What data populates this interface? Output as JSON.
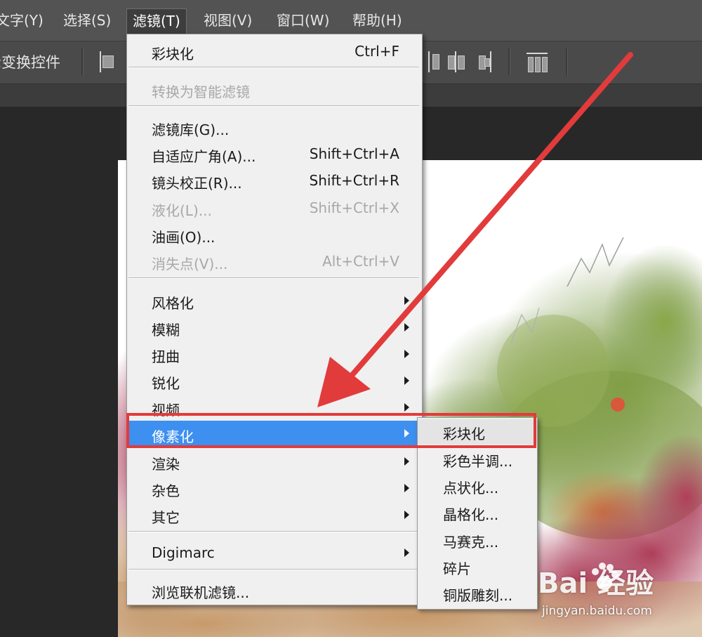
{
  "menubar": {
    "items": [
      {
        "label": "文字(Y)"
      },
      {
        "label": "选择(S)"
      },
      {
        "label": "滤镜(T)"
      },
      {
        "label": "视图(V)"
      },
      {
        "label": "窗口(W)"
      },
      {
        "label": "帮助(H)"
      }
    ]
  },
  "options_bar": {
    "label": "显示变换控件"
  },
  "filter_menu": {
    "items": [
      {
        "label": "彩块化",
        "shortcut": "Ctrl+F",
        "state": "enabled"
      },
      {
        "label": "转换为智能滤镜",
        "shortcut": "",
        "state": "disabled"
      },
      {
        "label": "滤镜库(G)...",
        "shortcut": "",
        "state": "enabled"
      },
      {
        "label": "自适应广角(A)...",
        "shortcut": "Shift+Ctrl+A",
        "state": "enabled"
      },
      {
        "label": "镜头校正(R)...",
        "shortcut": "Shift+Ctrl+R",
        "state": "enabled"
      },
      {
        "label": "液化(L)...",
        "shortcut": "Shift+Ctrl+X",
        "state": "disabled"
      },
      {
        "label": "油画(O)...",
        "shortcut": "",
        "state": "enabled"
      },
      {
        "label": "消失点(V)...",
        "shortcut": "Alt+Ctrl+V",
        "state": "disabled"
      },
      {
        "label": "风格化",
        "submenu": true
      },
      {
        "label": "模糊",
        "submenu": true
      },
      {
        "label": "扭曲",
        "submenu": true
      },
      {
        "label": "锐化",
        "submenu": true
      },
      {
        "label": "视频",
        "submenu": true
      },
      {
        "label": "像素化",
        "submenu": true,
        "highlighted": true
      },
      {
        "label": "渲染",
        "submenu": true
      },
      {
        "label": "杂色",
        "submenu": true
      },
      {
        "label": "其它",
        "submenu": true
      },
      {
        "label": "Digimarc",
        "submenu": true
      },
      {
        "label": "浏览联机滤镜..."
      }
    ]
  },
  "pixelate_submenu": {
    "items": [
      {
        "label": "彩块化"
      },
      {
        "label": "彩色半调..."
      },
      {
        "label": "点状化..."
      },
      {
        "label": "晶格化..."
      },
      {
        "label": "马赛克..."
      },
      {
        "label": "碎片"
      },
      {
        "label": "铜版雕刻..."
      }
    ]
  },
  "watermark": {
    "brand": "Bai  经验",
    "site": "jingyan.baidu.com"
  },
  "colors": {
    "menu_highlight": "#3d8ff0",
    "annotation_red": "#e23b3b",
    "menubar_bg": "#535353",
    "workspace_bg": "#282828"
  }
}
